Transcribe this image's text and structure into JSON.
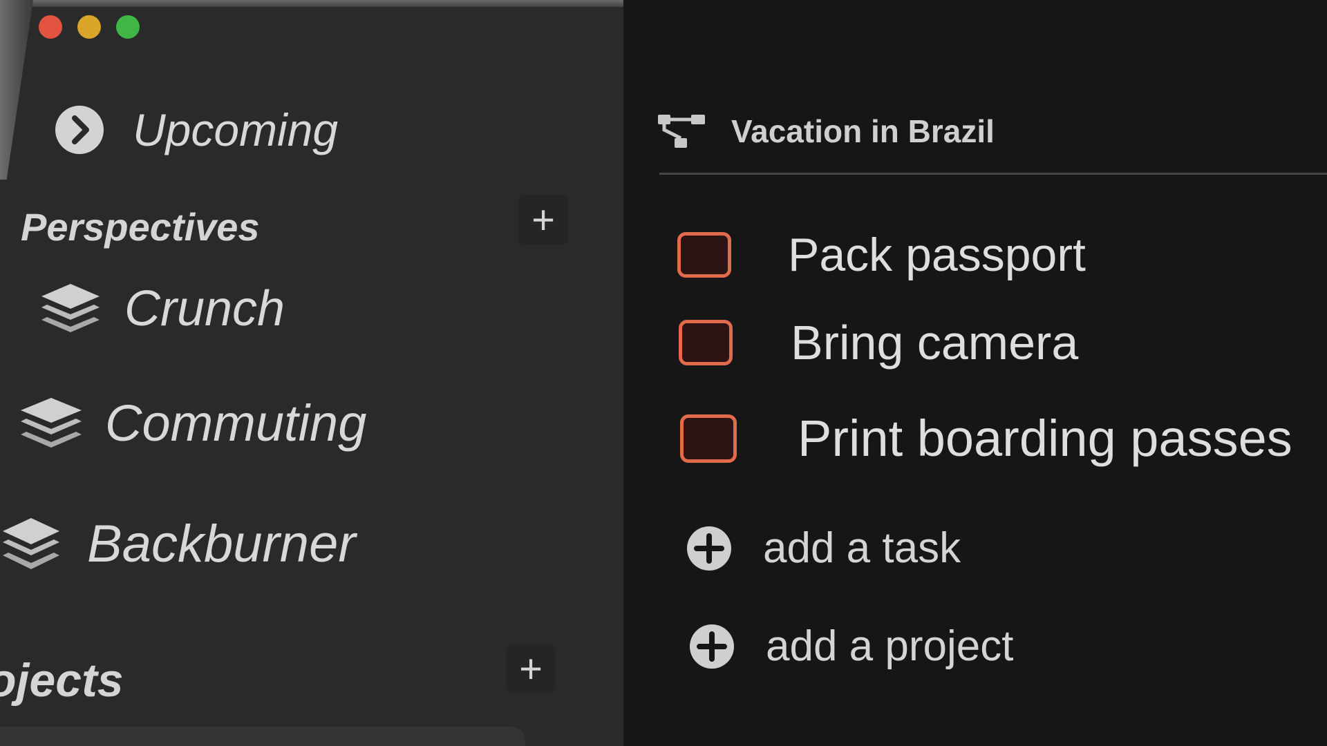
{
  "window": {
    "controls": [
      "close",
      "minimize",
      "zoom"
    ],
    "colors": {
      "close": "#e2543f",
      "minimize": "#d9a52a",
      "zoom": "#3fb645"
    }
  },
  "sidebar": {
    "upcoming": {
      "label": "Upcoming",
      "icon": "chevron-right-circle-icon"
    },
    "perspectives": {
      "heading": "Perspectives",
      "add_label": "+",
      "items": [
        {
          "label": "Crunch",
          "icon": "layers-icon"
        },
        {
          "label": "Commuting",
          "icon": "layers-icon"
        },
        {
          "label": "Backburner",
          "icon": "layers-icon"
        }
      ]
    },
    "projects": {
      "heading": "ojects",
      "add_label": "+"
    }
  },
  "main": {
    "project_title": "Vacation in Brazil",
    "project_icon": "project-hierarchy-icon",
    "tasks": [
      {
        "label": "Pack passport",
        "checked": false
      },
      {
        "label": "Bring camera",
        "checked": false
      },
      {
        "label": "Print boarding passes",
        "checked": false
      }
    ],
    "add_task_label": "add a task",
    "add_project_label": "add a project",
    "accent_color": "#e36a4a"
  }
}
